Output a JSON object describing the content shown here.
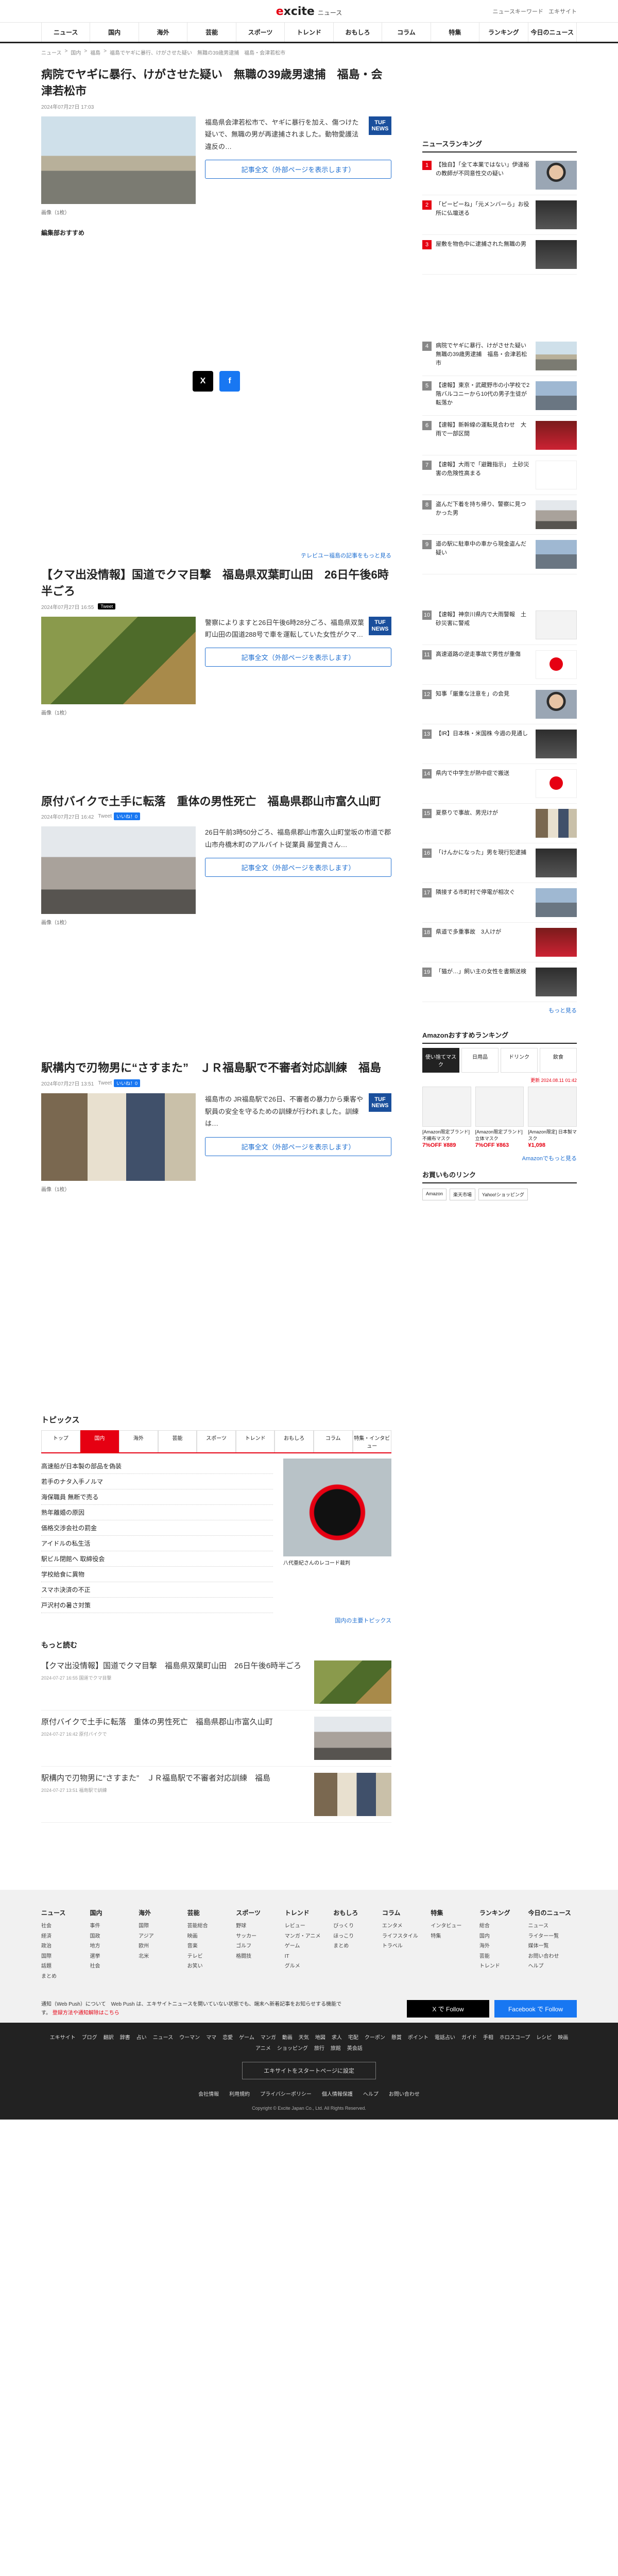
{
  "header": {
    "logo": "excite",
    "logo_sub": "ニュース",
    "links": [
      "ニュースキーワード",
      "エキサイト"
    ]
  },
  "nav": [
    "ニュース",
    "国内",
    "海外",
    "芸能",
    "スポーツ",
    "トレンド",
    "おもしろ",
    "コラム",
    "特集",
    "ランキング",
    "今日のニュース"
  ],
  "breadcrumb": [
    "ニュース",
    "国内",
    "福島",
    "福島でヤギに暴行、けがさせた疑い　無職の39歳男逮捕　福島・会津若松市"
  ],
  "articles": [
    {
      "title": "病院でヤギに暴行、けがさせた疑い　無職の39歳男逮捕　福島・会津若松市",
      "date": "2024年07月27日 17:03",
      "source": "TUF NEWS",
      "text": "福島県会津若松市で、ヤギに暴行を加え、傷つけた疑いで、無職の男が再逮捕されました。動物愛護法違反の…",
      "button": "記事全文（外部ページを表示します）",
      "photo_label": "画像（1枚）"
    },
    {
      "title": "【クマ出没情報】国道でクマ目撃　福島県双葉町山田　26日午後6時半ごろ",
      "date": "2024年07月27日 16:55",
      "source": "TUF NEWS",
      "text": "警察によりますと26日午後6時28分ごろ、福島県双葉町山田の国道288号で車を運転していた女性がクマ…",
      "button": "記事全文（外部ページを表示します）",
      "photo_label": "画像（1枚）"
    },
    {
      "title": "原付バイクで土手に転落　重体の男性死亡　福島県郡山市富久山町",
      "date": "2024年07月27日 16:42",
      "source": "",
      "text": "26日午前3時50分ごろ、福島県郡山市富久山町堂坂の市道で郡山市舟橋木町のアルバイト従業員 藤堂貴さん…",
      "button": "記事全文（外部ページを表示します）",
      "photo_label": "画像（1枚）"
    },
    {
      "title": "駅構内で刃物男に“さすまた”　ＪＲ福島駅で不審者対応訓練　福島",
      "date": "2024年07月27日 13:51",
      "source": "TUF NEWS",
      "text": "福島市の JR福島駅で26日、不審者の暴力から乗客や駅員の安全を守るための訓練が行われました。訓練は…",
      "button": "記事全文（外部ページを表示します）",
      "photo_label": "画像（1枚）"
    }
  ],
  "editor_pick": "編集部おすすめ",
  "more_tbs": "テレビユー福島の記事をもっと見る",
  "share": {
    "x": "X",
    "fb": "f",
    "like": "いいね！0",
    "tweet": "Tweet"
  },
  "ranking": {
    "title": "ニュースランキング",
    "more": "もっと見る",
    "items": [
      {
        "num": "1",
        "text": "【独自】「全て本業ではない」伊達裕の教師が不同意性交の疑い"
      },
      {
        "num": "2",
        "text": "「ピーピーね」「元メンバーら」お役所に仏壇送る"
      },
      {
        "num": "3",
        "text": "屋敷を物色中に逮捕された無職の男"
      },
      {
        "num": "4",
        "text": "病院でヤギに暴行、けがさせた疑い　無職の39歳男逮捕　福島・会津若松市"
      },
      {
        "num": "5",
        "text": "【速報】東京・武蔵野市の小学校で2階バルコニーから10代の男子生徒が転落か"
      },
      {
        "num": "6",
        "text": "【速報】新幹線の運転見合わせ　大雨で一部区間"
      },
      {
        "num": "7",
        "text": "【速報】大雨で「避難指示」　土砂災害の危険性高まる"
      },
      {
        "num": "8",
        "text": "盗んだ下着を持ち帰り、警察に見つかった男"
      },
      {
        "num": "9",
        "text": "道の駅に駐車中の車から現金盗んだ疑い"
      },
      {
        "num": "10",
        "text": "【速報】神奈川県内で大雨警報　土砂災害に警戒"
      },
      {
        "num": "11",
        "text": "高速道路の逆走事故で男性が重傷"
      },
      {
        "num": "12",
        "text": "知事「厳重な注意を」の会見"
      },
      {
        "num": "13",
        "text": "【IR】日本株・米国株 今週の見通し"
      },
      {
        "num": "14",
        "text": "県内で中学生が熱中症で搬送"
      },
      {
        "num": "15",
        "text": "夏祭りで事故、男児けが"
      },
      {
        "num": "16",
        "text": "「けんかになった」男を現行犯逮捕"
      },
      {
        "num": "17",
        "text": "隣接する市町村で停電が相次ぐ"
      },
      {
        "num": "18",
        "text": "県道で多重事故　3人けが"
      },
      {
        "num": "19",
        "text": "「猫が…」飼い主の女性を書類送検"
      }
    ]
  },
  "amazon": {
    "title": "Amazonおすすめランキング",
    "tabs": [
      "使い捨てマスク",
      "日用品",
      "ドリンク",
      "飲食"
    ],
    "updated": "更新 2024.08.11 01:42",
    "products": [
      {
        "name": "[Amazon限定ブランド] 不織布マスク",
        "price": "7%OFF ¥889"
      },
      {
        "name": "[Amazon限定ブランド] 立体マスク",
        "price": "7%OFF ¥863"
      },
      {
        "name": "[Amazon限定] 日本製マスク",
        "price": "¥1,098"
      }
    ],
    "more": "Amazonでもっと見る",
    "links_title": "お買いものリンク",
    "chips": [
      "Amazon",
      "楽天市場",
      "Yahoo!ショッピング"
    ]
  },
  "topics": {
    "title": "トピックス",
    "tabs": [
      "トップ",
      "国内",
      "海外",
      "芸能",
      "スポーツ",
      "トレンド",
      "おもしろ",
      "コラム",
      "特集・インタビュー"
    ],
    "items": [
      "高速船が日本製の部品を偽装",
      "若手のナタ入手ノルマ",
      "海保職員 無断で売る",
      "熟年離婚の原因",
      "価格交渉会社の罰金",
      "アイドルの私生活",
      "駅ビル閉館へ 取締役会",
      "学校給食に異物",
      "スマホ決済の不正",
      "戸沢村の暑さ対策"
    ],
    "photo_caption": "八代亜紀さんのレコード裁判",
    "more": "国内の主要トピックス"
  },
  "more_read": {
    "title": "もっと読む",
    "items": [
      {
        "title": "【クマ出没情報】国道でクマ目撃　福島県双葉町山田　26日午後6時半ごろ",
        "date": "2024-07-27 16:55  国道でクマ目撃"
      },
      {
        "title": "原付バイクで土手に転落　重体の男性死亡　福島県郡山市富久山町",
        "date": "2024-07-27 16:42  原付バイクで"
      },
      {
        "title": "駅構内で刃物男に“さすまた”　ＪＲ福島駅で不審者対応訓練　福島",
        "date": "2024-07-27 13:51  福島駅で訓練"
      }
    ]
  },
  "footer": {
    "cols": [
      {
        "h": "ニュース",
        "li": [
          "社会",
          "経済",
          "政治",
          "国際",
          "話題",
          "まとめ"
        ]
      },
      {
        "h": "国内",
        "li": [
          "事件",
          "国政",
          "地方",
          "選挙",
          "社会"
        ]
      },
      {
        "h": "海外",
        "li": [
          "国際",
          "アジア",
          "欧州",
          "北米"
        ]
      },
      {
        "h": "芸能",
        "li": [
          "芸能総合",
          "映画",
          "音楽",
          "テレビ",
          "お笑い"
        ]
      },
      {
        "h": "スポーツ",
        "li": [
          "野球",
          "サッカー",
          "ゴルフ",
          "格闘技"
        ]
      },
      {
        "h": "トレンド",
        "li": [
          "レビュー",
          "マンガ・アニメ",
          "ゲーム",
          "IT",
          "グルメ"
        ]
      },
      {
        "h": "おもしろ",
        "li": [
          "びっくり",
          "ほっこり",
          "まとめ"
        ]
      },
      {
        "h": "コラム",
        "li": [
          "エンタメ",
          "ライフスタイル",
          "トラベル"
        ]
      },
      {
        "h": "特集",
        "li": [
          "インタビュー",
          "特集"
        ]
      },
      {
        "h": "ランキング",
        "li": [
          "総合",
          "国内",
          "海外",
          "芸能",
          "トレンド"
        ]
      },
      {
        "h": "今日のニュース",
        "li": [
          "ニュース",
          "ライター一覧",
          "媒体一覧",
          "お問い合わせ",
          "ヘルプ"
        ]
      }
    ],
    "notice": "通知（Web Push）について　Web Push は、エキサイトニュースを開いていない状態でも、端末へ新着記事をお知らせする機能です。",
    "notice_link": "登録方法や通知解除はこちら",
    "follow_x": "X で Follow",
    "follow_fb": "Facebook で Follow"
  },
  "footer_dark": {
    "sites": [
      "エキサイト",
      "ブログ",
      "翻訳",
      "辞書",
      "占い",
      "ニュース",
      "ウーマン",
      "ママ",
      "恋愛",
      "ゲーム",
      "マンガ",
      "動画",
      "天気",
      "地図",
      "求人",
      "宅配",
      "クーポン",
      "懸賞",
      "ポイント",
      "電話占い",
      "ガイド",
      "手相",
      "ホロスコープ",
      "レシピ",
      "映画",
      "アニメ",
      "ショッピング",
      "旅行",
      "旅館",
      "英会話"
    ],
    "set_home": "エキサイトをスタートページに設定",
    "bottom": [
      "会社情報",
      "利用規約",
      "プライバシーポリシー",
      "個人情報保護",
      "ヘルプ",
      "お問い合わせ"
    ],
    "copyright": "Copyright © Excite Japan Co., Ltd. All Rights Reserved."
  }
}
